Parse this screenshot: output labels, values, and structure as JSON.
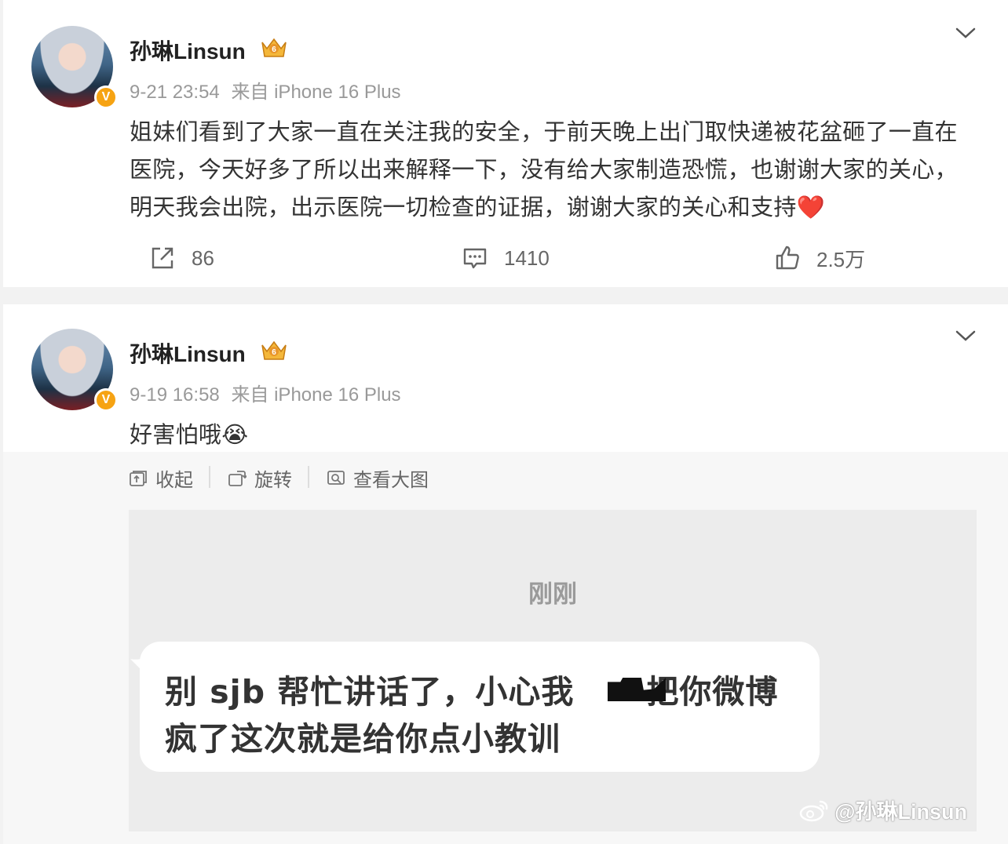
{
  "posts": [
    {
      "user": {
        "name": "孙琳Linsun",
        "vip_level": "6",
        "verified_mark": "V"
      },
      "timestamp": "9-21 23:54",
      "source": "来自 iPhone 16 Plus",
      "content_lines": [
        "姐妹们看到了大家一直在关注我的安全，于前天晚上出门取快递被花盆砸了一直在",
        "医院，今天好多了所以出来解释一下，没有给大家制造恐慌，也谢谢大家的关心，",
        "明天我会出院，出示医院一切检查的证据，谢谢大家的关心和支持❤️"
      ],
      "actions": {
        "reposts": "86",
        "comments": "1410",
        "likes": "2.5万"
      }
    },
    {
      "user": {
        "name": "孙琳Linsun",
        "vip_level": "6",
        "verified_mark": "V"
      },
      "timestamp": "9-19 16:58",
      "source": "来自 iPhone 16 Plus",
      "content": "好害怕哦😭",
      "media_toolbar": {
        "collapse": "收起",
        "rotate": "旋转",
        "view_large": "查看大图"
      },
      "image": {
        "time_label": "刚刚",
        "message_line1_a": "别 sjb 帮忙讲话了，小心我",
        "message_line1_b": "把你微博",
        "message_line2": "疯了这次就是给你点小教训",
        "watermark": "@孙琳Linsun"
      }
    }
  ],
  "colors": {
    "verify": "#f6a313",
    "text": "#333333",
    "meta": "#999999",
    "background": "#f2f2f2"
  },
  "icons": [
    "repost-icon",
    "comment-icon",
    "like-icon",
    "chevron-down-icon",
    "vip-crown-icon",
    "collapse-icon",
    "rotate-icon",
    "view-large-icon",
    "weibo-logo-icon"
  ]
}
